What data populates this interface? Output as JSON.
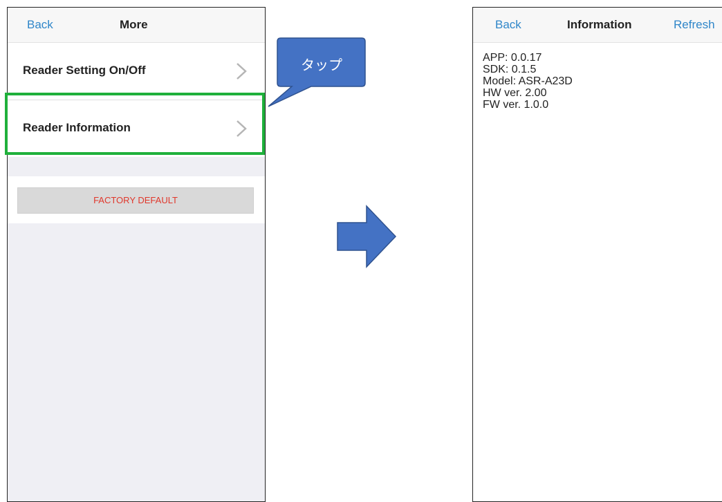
{
  "left_screen": {
    "nav": {
      "back": "Back",
      "title": "More"
    },
    "rows": [
      {
        "label": "Reader Setting On/Off"
      },
      {
        "label": "Reader Information"
      }
    ],
    "factory_default": "FACTORY DEFAULT"
  },
  "callout": {
    "text": "タップ"
  },
  "right_screen": {
    "nav": {
      "back": "Back",
      "title": "Information",
      "refresh": "Refresh"
    },
    "info": [
      "APP: 0.0.17",
      "SDK: 0.1.5",
      "Model: ASR-A23D",
      "HW ver. 2.00",
      "FW ver. 1.0.0"
    ]
  },
  "colors": {
    "link": "#2f86c9",
    "highlight": "#1fb03b",
    "callout": "#4472c4",
    "danger_text": "#e0372b"
  },
  "icons": [
    "chevron-right-icon",
    "arrow-right-icon"
  ]
}
